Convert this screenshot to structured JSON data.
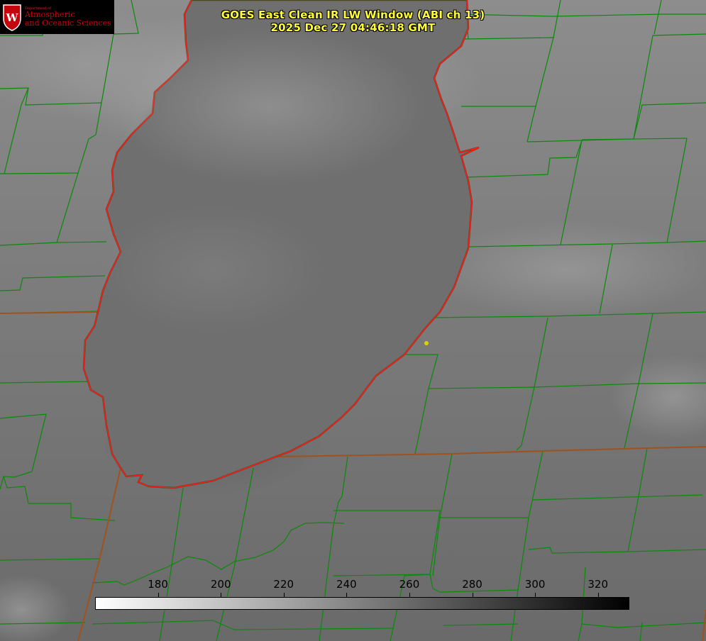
{
  "title": {
    "line1": "GOES East Clean IR LW Window (ABI ch 13)",
    "line2": "2025 Dec 27 04:46:18 GMT"
  },
  "logo": {
    "dept": "Department of",
    "line1": "Atmospheric",
    "line2": "and Oceanic Sciences",
    "shield_icon": "uw-crest-icon"
  },
  "colorbar": {
    "min": 160,
    "max": 330,
    "ticks": [
      "180",
      "200",
      "220",
      "240",
      "260",
      "280",
      "300",
      "320"
    ],
    "start_color": "#ffffff",
    "end_color": "#000000"
  },
  "colors": {
    "county_lines": "#0a8a0a",
    "state_lines": "#a0521e",
    "lake_shoreline": "#ff1a1a",
    "station_marker": "#e0d000",
    "title_text": "#ffff33"
  },
  "map_features": {
    "feature": "lake-shoreline",
    "station_marker": "station-dot-icon"
  }
}
